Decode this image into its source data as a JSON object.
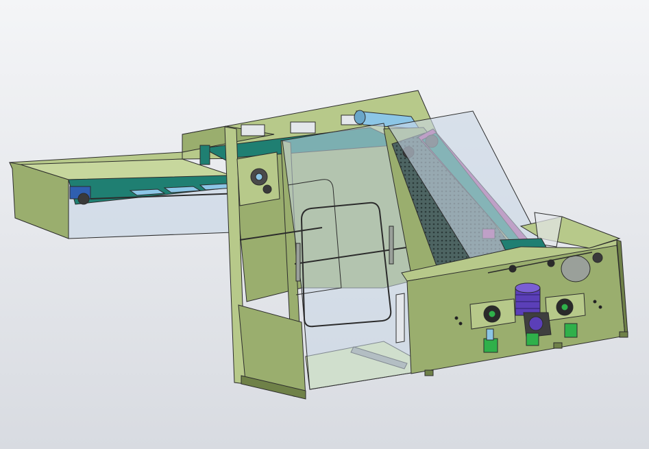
{
  "viewport": {
    "background_top": "#f4f5f7",
    "background_bottom": "#d8dbe1"
  },
  "colors": {
    "frame_green": "#9aae6e",
    "frame_green_light": "#b7c98a",
    "frame_green_dark": "#6f8148",
    "floor_green": "#d9e8b0",
    "belt_teal": "#1f7f72",
    "belt_teal_dark": "#14564e",
    "roller_blue": "#8cc6e6",
    "glass": "#c9d7e6",
    "magenta": "#b04f9a",
    "motor_purple": "#5b3fb8",
    "part_green": "#2fb04a",
    "part_dark": "#1f1f1f",
    "edge": "#2b2b2b"
  },
  "model": {
    "view": "isometric",
    "outline_color": "#2b2b2b"
  }
}
